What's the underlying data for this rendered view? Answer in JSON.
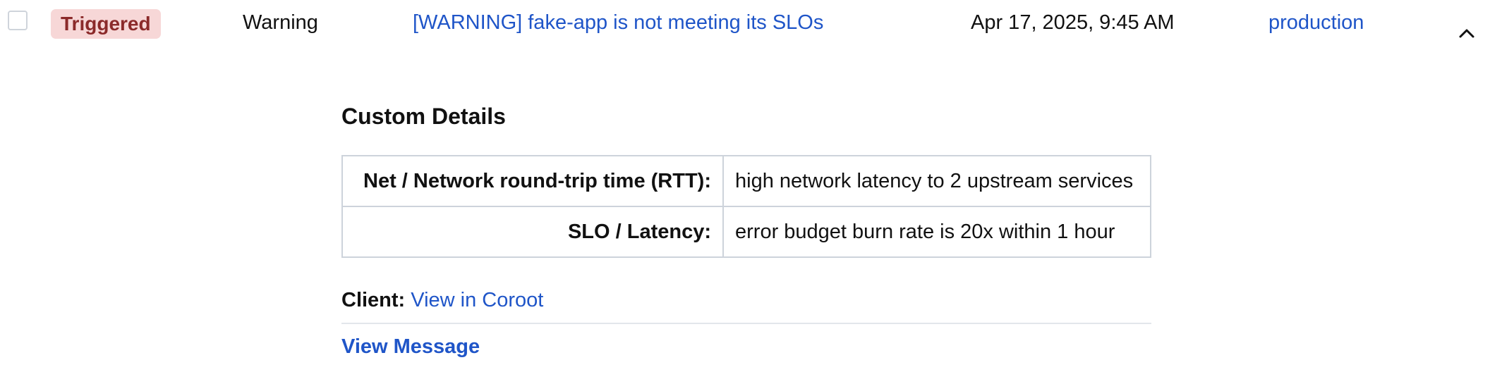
{
  "alert": {
    "status": "Triggered",
    "severity": "Warning",
    "title": "[WARNING] fake-app is not meeting its SLOs",
    "timestamp": "Apr 17, 2025, 9:45 AM",
    "environment": "production",
    "expand_icon": "chevron-up-icon",
    "colors": {
      "status_bg": "#f7d7d7",
      "status_text": "#8b2a2a",
      "link": "#1f55c8"
    }
  },
  "details": {
    "heading": "Custom Details",
    "rows": [
      {
        "key": "Net / Network round-trip time (RTT):",
        "value": "high network latency to 2 upstream services"
      },
      {
        "key": "SLO / Latency:",
        "value": "error budget burn rate is 20x within 1 hour"
      }
    ],
    "client_label": "Client:",
    "client_link": "View in Coroot",
    "view_message": "View Message"
  }
}
